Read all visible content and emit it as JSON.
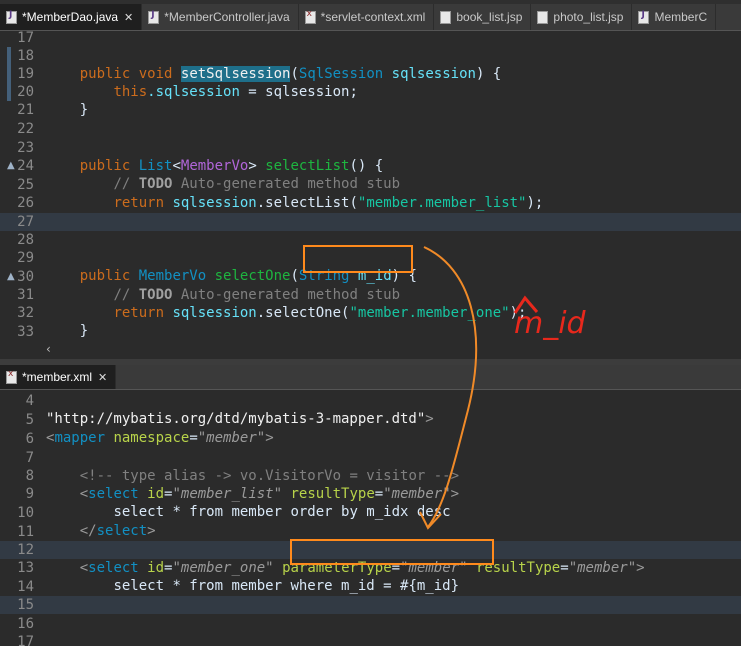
{
  "top_tabs": [
    {
      "label": "*MemberDao.java",
      "icon": "java-file-icon",
      "active": true
    },
    {
      "label": "*MemberController.java",
      "icon": "java-file-icon"
    },
    {
      "label": "*servlet-context.xml",
      "icon": "xml-file-icon"
    },
    {
      "label": "book_list.jsp",
      "icon": "jsp-file-icon"
    },
    {
      "label": "photo_list.jsp",
      "icon": "jsp-file-icon"
    },
    {
      "label": "MemberC",
      "icon": "java-file-icon"
    }
  ],
  "bottom_tabs": [
    {
      "label": "*member.xml",
      "icon": "xml-file-icon",
      "active": true
    }
  ],
  "java_lines": {
    "l17": "17",
    "l18": "18",
    "l19": "19",
    "l20": "20",
    "l21": "21",
    "l22": "22",
    "l23": "23",
    "l24": "24",
    "l25": "25",
    "l26": "26",
    "l27": "27",
    "l28": "28",
    "l29": "29",
    "l30": "30",
    "l31": "31",
    "l32": "32",
    "l33": "33"
  },
  "java_code": {
    "public": "public",
    "void": "void",
    "set_method": "setSqlsession",
    "sqlsession_type": "SqlSession",
    "sqlsession_param": "sqlsession",
    "this": "this",
    "this_field": ".sqlsession",
    "assign_rhs": " = sqlsession;",
    "list_type": "List",
    "membervo": "MemberVo",
    "select_list": "selectList",
    "todo_comment_prefix": "// ",
    "todo": "TODO",
    "todo_comment_suffix": " Auto-generated method stub",
    "return": "return",
    "sqlsession_call": "sqlsession",
    "select_list_call": ".selectList(",
    "member_list_str": "\"member.member_list\"",
    "select_one": "selectOne",
    "string_type": "String",
    "m_id": "m_id",
    "select_one_call": ".selectOne(",
    "member_one_str": "\"member.member_one\""
  },
  "annotation": "m_id",
  "xml_lines": {
    "l4": "4",
    "l5": "5",
    "l6": "6",
    "l7": "7",
    "l8": "8",
    "l9": "9",
    "l10": "10",
    "l11": "11",
    "l12": "12",
    "l13": "13",
    "l14": "14",
    "l15": "15",
    "l16": "16",
    "l17": "17"
  },
  "xml_code": {
    "dtd_url": "\"http://mybatis.org/dtd/mybatis-3-mapper.dtd\"",
    "mapper": "mapper",
    "namespace_attr": "namespace",
    "namespace_val": "\"member\"",
    "comment": "<!-- type alias -> vo.VisitorVo = visitor -->",
    "select": "select",
    "id_attr": "id",
    "member_list_val": "\"member_list\"",
    "resulttype_attr": "resultType",
    "member_val": "\"member\"",
    "query_list": "select * from member order by m_idx desc",
    "member_one_val": "\"member_one\"",
    "parametertype_attr": "parameterType",
    "query_one": "select * from member where m_id = #{m_id}"
  },
  "colors": {
    "highlight_box": "#ff8a1c",
    "annotation_red": "#e8281c",
    "arrow": "#f08a28"
  }
}
